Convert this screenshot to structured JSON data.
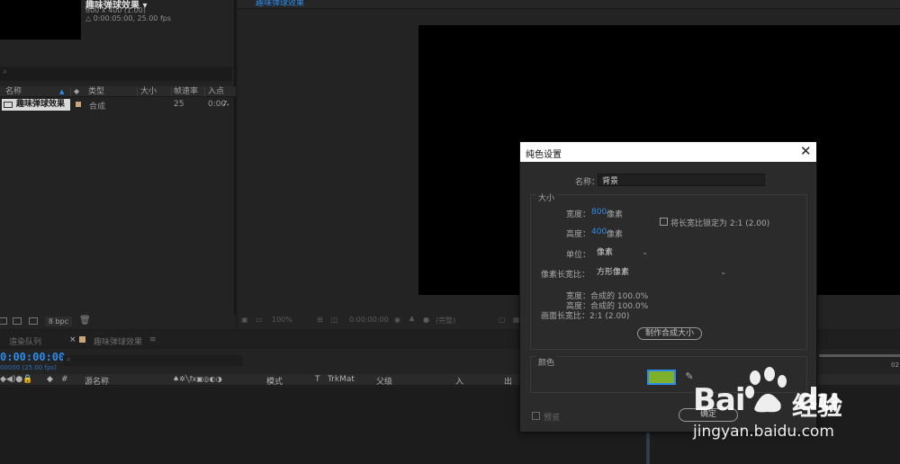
{
  "project": {
    "comp_name": "趣味弹球效果 ▾",
    "comp_dims": "800 x 400 (1.00)",
    "comp_duration": "△ 0:00:05:00, 25.00 fps",
    "search_placeholder": "",
    "columns": {
      "name": "名称",
      "type": "类型",
      "size": "大小",
      "fps": "帧速率",
      "in": "入点"
    },
    "row": {
      "name": "趣味弹球效果",
      "type": "合成",
      "fps": "25",
      "in": "0:00"
    },
    "bpc": "8 bpc"
  },
  "viewer": {
    "tab_label": "趣味弹球效果",
    "zoom": "100%",
    "timecode": "0:00:00:00",
    "quality": "(完整)"
  },
  "timeline": {
    "tab_render": "渲染队列",
    "tab_close": "×",
    "tab_comp": "趣味弹球效果",
    "tab_menu": "≡",
    "timecode": "0:00:00:00",
    "timecode_fps": "00000 (25.00 fps)",
    "columns": {
      "source": "源名称",
      "mode": "模式",
      "t": "T",
      "trkmat": "TrkMat",
      "parent": "父级",
      "in": "入",
      "out": "出"
    },
    "ruler_label": "02"
  },
  "dialog": {
    "title": "纯色设置",
    "close": "✕",
    "name_label": "名称：",
    "name_value": "背景",
    "size_group": "大小",
    "width_label": "宽度：",
    "width_value": "800",
    "width_unit": "像素",
    "height_label": "高度：",
    "height_value": "400",
    "height_unit": "像素",
    "lock_label": "将长宽比锁定为 2:1 (2.00)",
    "units_label": "单位：",
    "units_value": "像素",
    "pixel_aspect_label": "像素长宽比：",
    "pixel_aspect_value": "方形像素",
    "info_width": "宽度：合成的 100.0%",
    "info_height": "高度：合成的 100.0%",
    "info_frame": "画面长宽比：2:1 (2.00)",
    "make_comp_size": "制作合成大小",
    "color_group": "颜色",
    "color_value": "#7db02b",
    "preview_label": "预览",
    "ok_label": "确定"
  },
  "watermark": {
    "brand": "Bai",
    "brand_suffix": "du",
    "cn": "经验",
    "url": "jingyan.baidu.com"
  }
}
